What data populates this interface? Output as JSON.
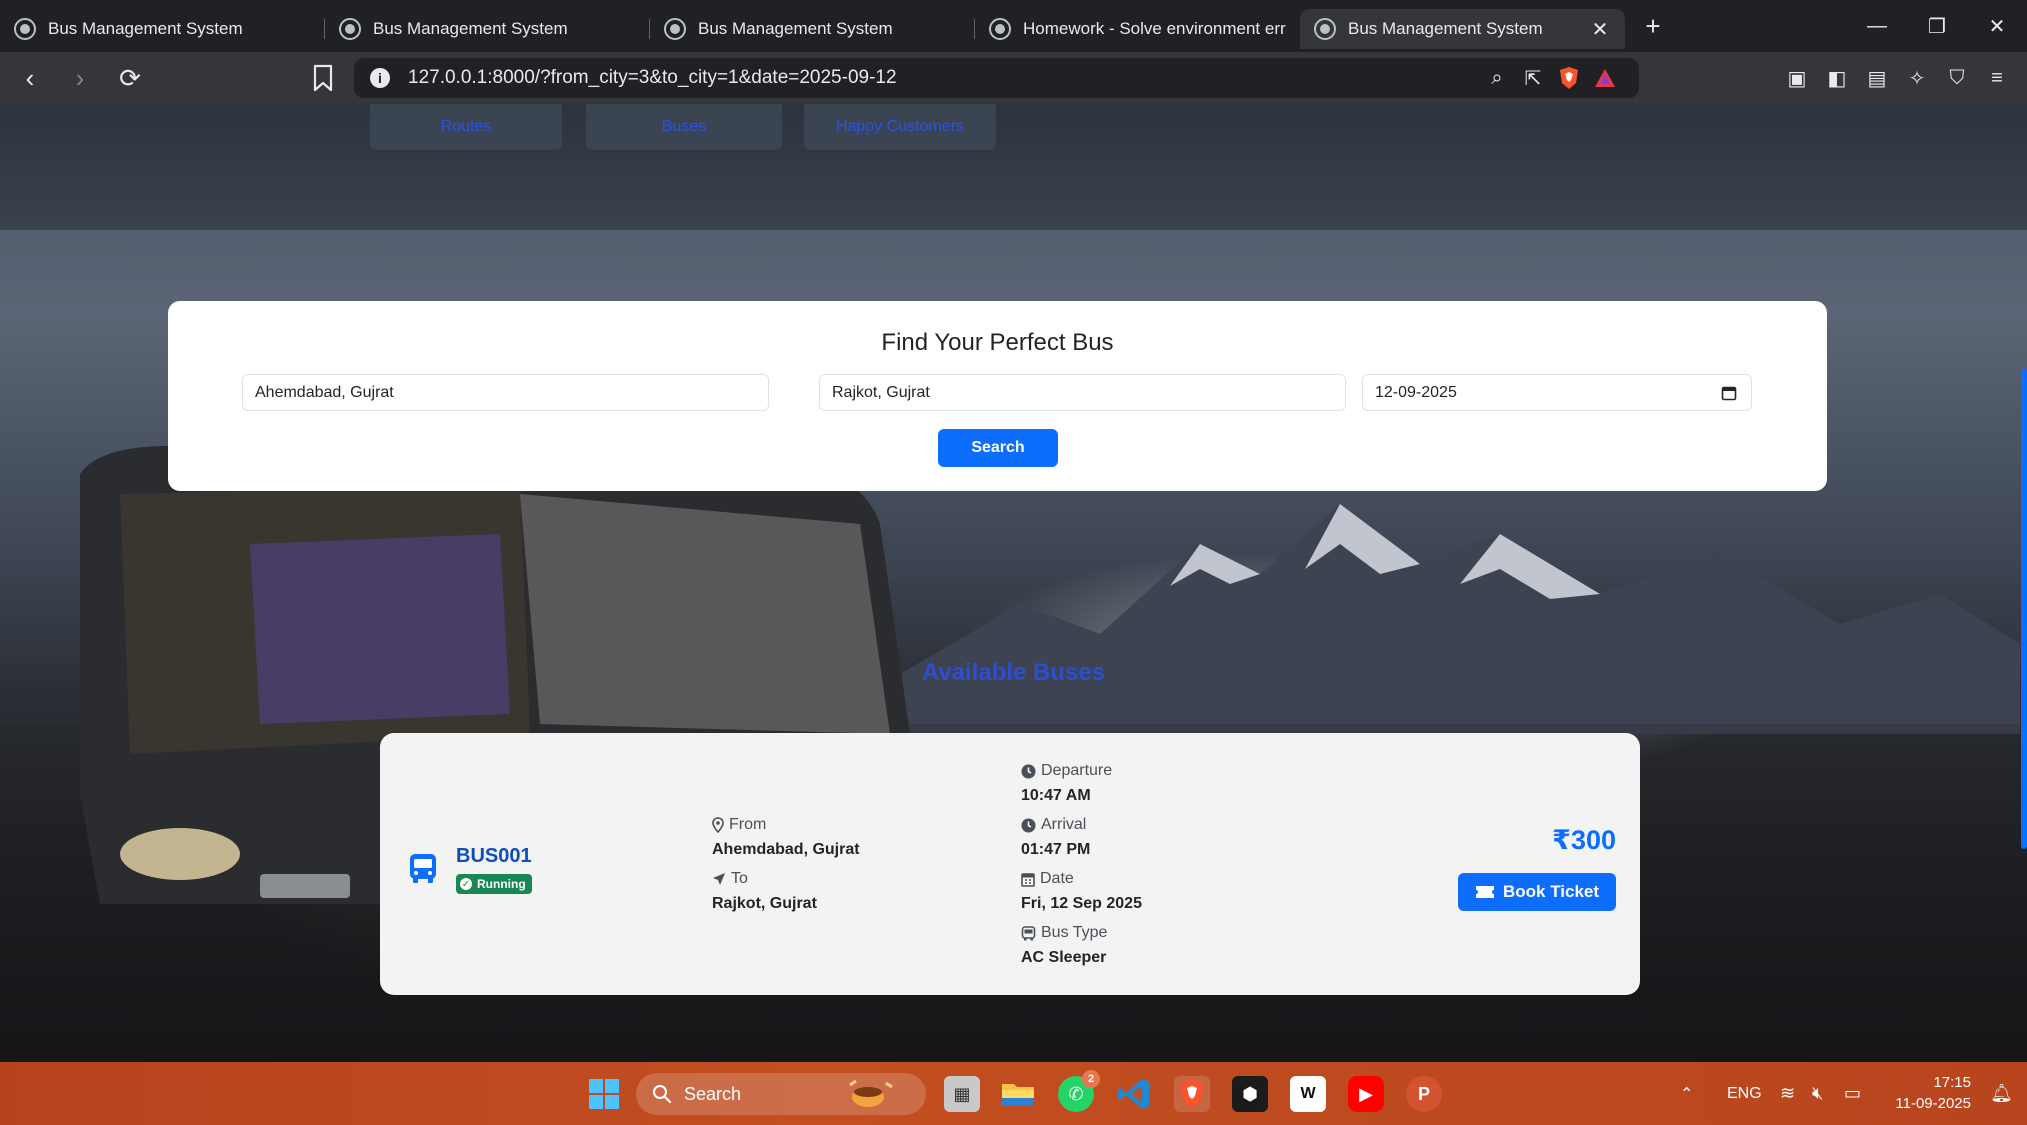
{
  "browser": {
    "tabs": [
      {
        "title": "Bus Management System",
        "active": false
      },
      {
        "title": "Bus Management System",
        "active": false
      },
      {
        "title": "Bus Management System",
        "active": false
      },
      {
        "title": "Homework - Solve environment error",
        "active": false
      },
      {
        "title": "Bus Management System",
        "active": true
      }
    ],
    "url": "127.0.0.1:8000/?from_city=3&to_city=1&date=2025-09-12"
  },
  "stats": [
    {
      "label": "Routes"
    },
    {
      "label": "Buses"
    },
    {
      "label": "Happy Customers"
    }
  ],
  "search": {
    "title": "Find Your Perfect Bus",
    "from_value": "Ahemdabad, Gujrat",
    "to_value": "Rajkot, Gujrat",
    "date_value": "12-09-2025",
    "button_label": "Search"
  },
  "results": {
    "heading": "Available Buses",
    "buses": [
      {
        "number": "BUS001",
        "status": "Running",
        "from_label": "From",
        "from": "Ahemdabad, Gujrat",
        "to_label": "To",
        "to": "Rajkot, Gujrat",
        "departure_label": "Departure",
        "departure": "10:47 AM",
        "arrival_label": "Arrival",
        "arrival": "01:47 PM",
        "date_label": "Date",
        "date": "Fri, 12 Sep 2025",
        "type_label": "Bus Type",
        "type": "AC Sleeper",
        "fare": "₹300",
        "book_label": "Book Ticket"
      }
    ]
  },
  "taskbar": {
    "search_label": "Search",
    "whatsapp_badge": "2",
    "language": "ENG",
    "time": "17:15",
    "date": "11-09-2025"
  },
  "colors": {
    "primary": "#0d6efd",
    "running": "#198754",
    "taskbar": "#c24e21"
  }
}
